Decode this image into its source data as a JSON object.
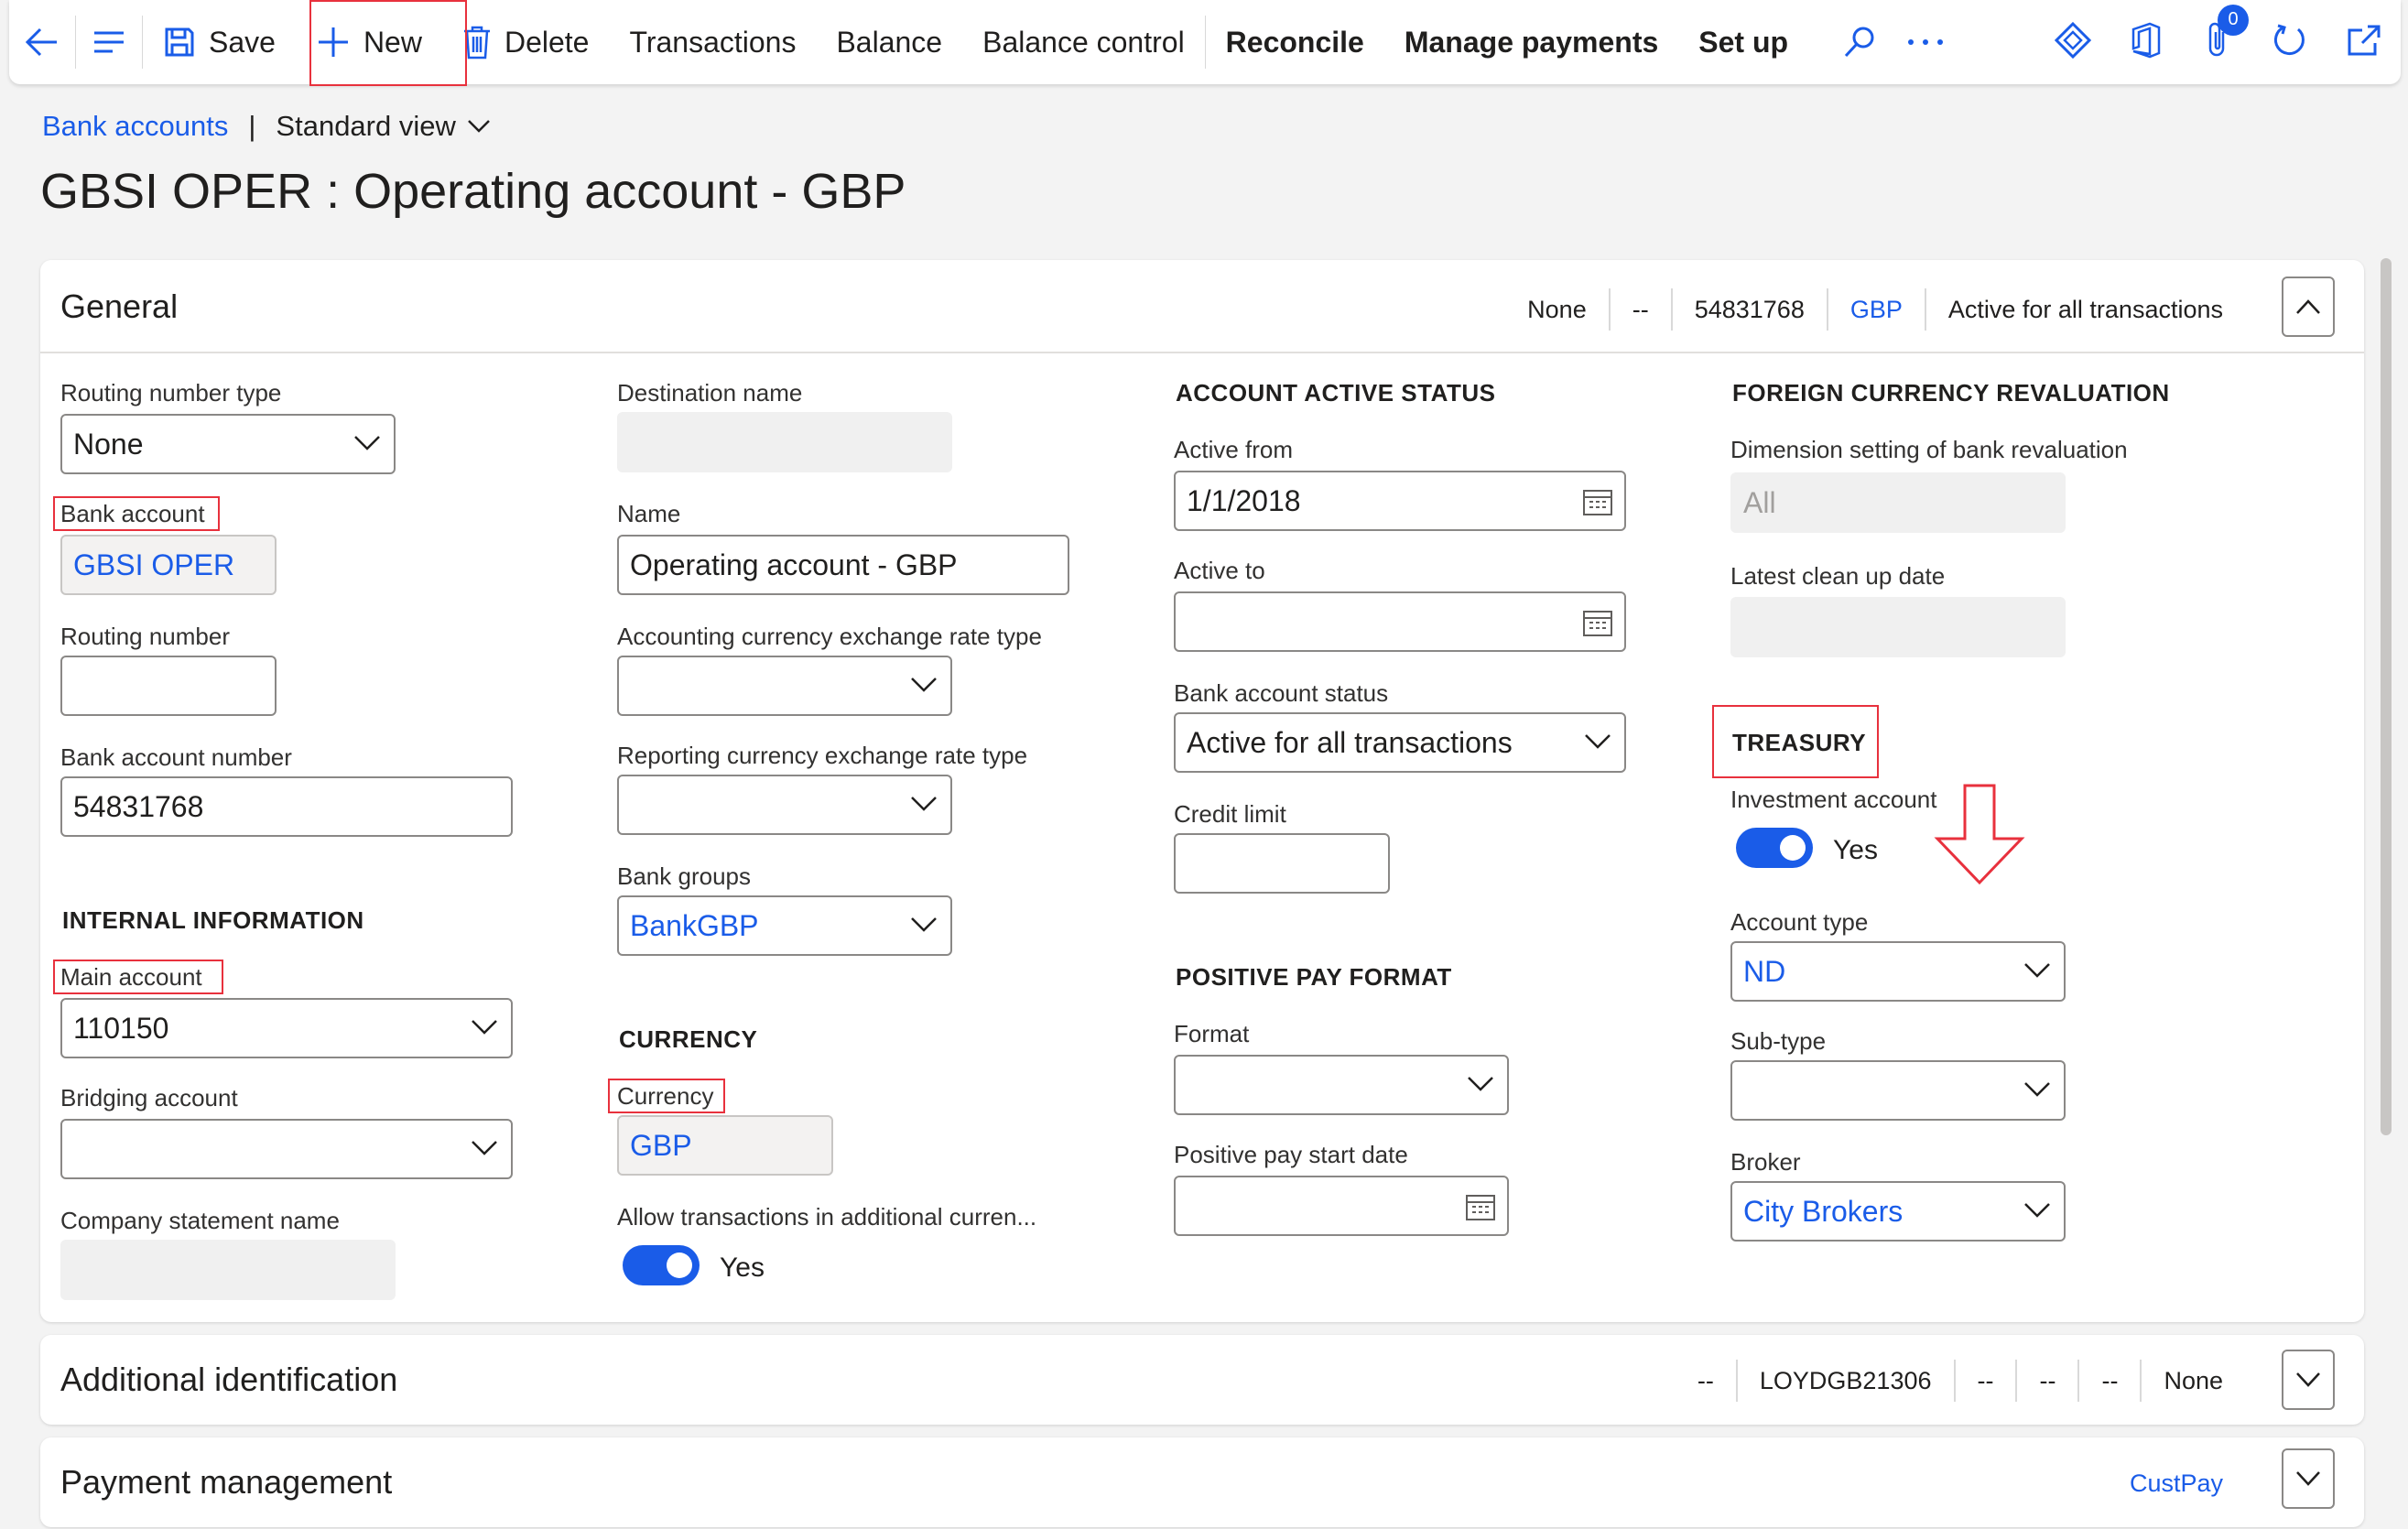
{
  "toolbar": {
    "save": "Save",
    "new": "New",
    "delete": "Delete",
    "transactions": "Transactions",
    "balance": "Balance",
    "balance_control": "Balance control",
    "reconcile": "Reconcile",
    "manage_payments": "Manage payments",
    "set_up": "Set up",
    "attachments_count": "0"
  },
  "breadcrumb": {
    "link": "Bank accounts",
    "separator": "|",
    "view": "Standard view"
  },
  "title": "GBSI OPER : Operating account - GBP",
  "general": {
    "header": "General",
    "summary": {
      "routing": "None",
      "dash": "--",
      "account_number": "54831768",
      "currency": "GBP",
      "status": "Active for all transactions"
    },
    "col1": {
      "routing_number_type_label": "Routing number type",
      "routing_number_type": "None",
      "bank_account_label": "Bank account",
      "bank_account": "GBSI OPER",
      "routing_number_label": "Routing number",
      "routing_number": "",
      "bank_account_number_label": "Bank account number",
      "bank_account_number": "54831768",
      "internal_info_header": "INTERNAL INFORMATION",
      "main_account_label": "Main account",
      "main_account": "110150",
      "bridging_account_label": "Bridging account",
      "bridging_account": "",
      "company_statement_name_label": "Company statement name",
      "company_statement_name": ""
    },
    "col2": {
      "destination_name_label": "Destination name",
      "destination_name": "",
      "name_label": "Name",
      "name": "Operating account - GBP",
      "acct_rate_type_label": "Accounting currency exchange rate type",
      "acct_rate_type": "",
      "rep_rate_type_label": "Reporting currency exchange rate type",
      "rep_rate_type": "",
      "bank_groups_label": "Bank groups",
      "bank_groups": "BankGBP",
      "currency_header": "CURRENCY",
      "currency_label": "Currency",
      "currency": "GBP",
      "allow_additional_label": "Allow transactions in additional curren...",
      "allow_additional": "Yes"
    },
    "col3": {
      "active_status_header": "ACCOUNT ACTIVE STATUS",
      "active_from_label": "Active from",
      "active_from": "1/1/2018",
      "active_to_label": "Active to",
      "active_to": "",
      "status_label": "Bank account status",
      "status": "Active for all transactions",
      "credit_limit_label": "Credit limit",
      "credit_limit": "",
      "positive_pay_header": "POSITIVE PAY FORMAT",
      "format_label": "Format",
      "format": "",
      "pp_start_label": "Positive pay start date",
      "pp_start": ""
    },
    "col4": {
      "fcr_header": "FOREIGN CURRENCY REVALUATION",
      "dimension_label": "Dimension setting of bank revaluation",
      "dimension": "All",
      "cleanup_label": "Latest clean up date",
      "cleanup": "",
      "treasury_header": "TREASURY",
      "investment_label": "Investment account",
      "investment": "Yes",
      "account_type_label": "Account type",
      "account_type": "ND",
      "subtype_label": "Sub-type",
      "subtype": "",
      "broker_label": "Broker",
      "broker": "City Brokers"
    }
  },
  "additional": {
    "header": "Additional identification",
    "s1": "--",
    "s2": "LOYDGB21306",
    "s3": "--",
    "s4": "--",
    "s5": "--",
    "s6": "None"
  },
  "payment": {
    "header": "Payment management",
    "link": "CustPay"
  },
  "colors": {
    "accent": "#1a5ce8",
    "highlight": "#e8313d"
  }
}
